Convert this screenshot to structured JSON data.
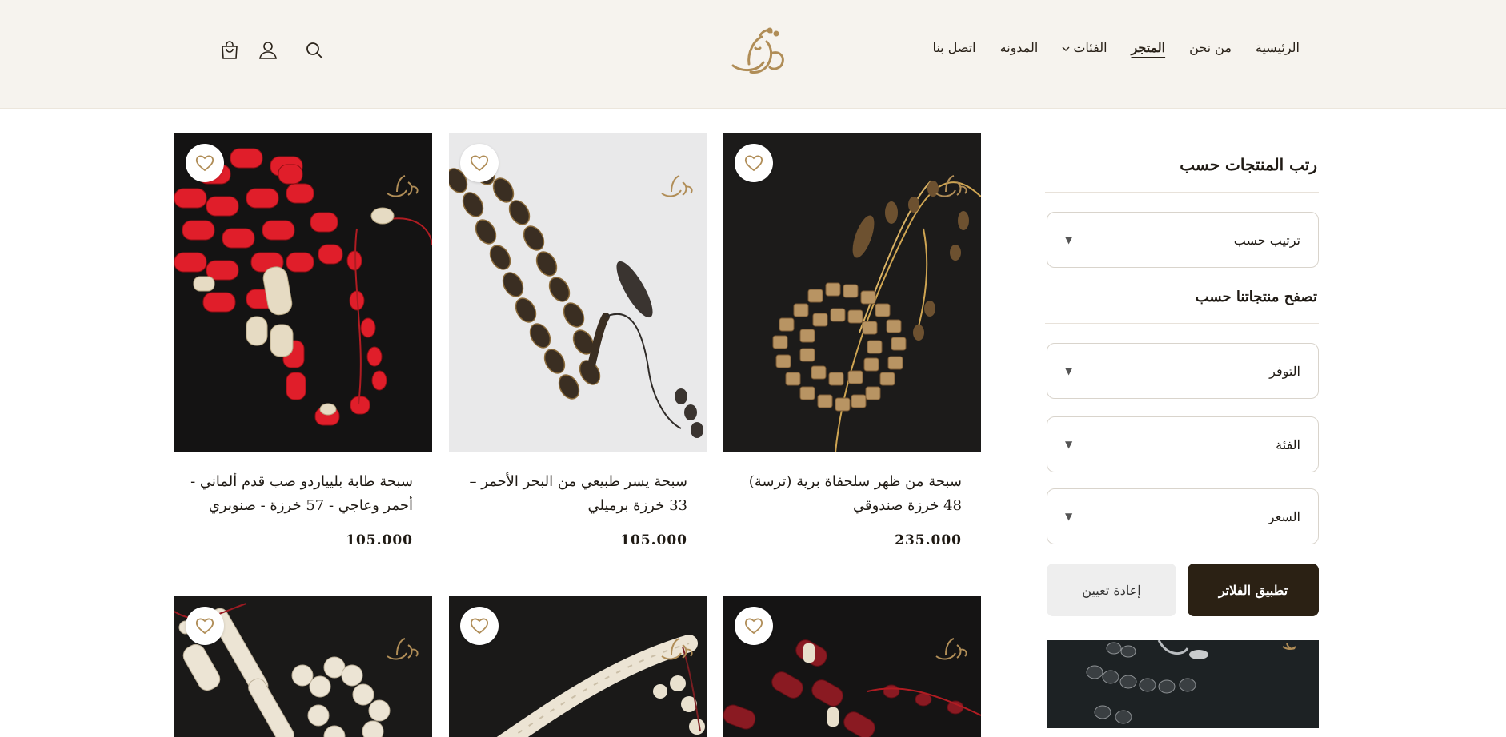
{
  "colors": {
    "header_bg": "#f6f3ee",
    "gold": "#b08d57",
    "apply_bg": "#2b2114"
  },
  "header": {
    "nav": [
      {
        "label": "الرئيسية",
        "active": false
      },
      {
        "label": "من نحن",
        "active": false
      },
      {
        "label": "المتجر",
        "active": true
      },
      {
        "label": "الفئات",
        "active": false,
        "dropdown": true
      },
      {
        "label": "المدونه",
        "active": false
      },
      {
        "label": "اتصل بنا",
        "active": false
      }
    ],
    "icons": [
      "search-icon",
      "user-icon",
      "cart-icon"
    ]
  },
  "sidebar": {
    "sort_title": "رتب المنتجات حسب",
    "sort_select": "ترتيب حسب",
    "browse_title": "تصفح منتجاتنا حسب",
    "filters": [
      "التوفر",
      "الفئة",
      "السعر"
    ],
    "apply_label": "تطبيق الفلاتر",
    "reset_label": "إعادة تعيين"
  },
  "products": [
    {
      "title": "سبحة من ظهر سلحفاة برية (ترسة) 48 خرزة صندوقي",
      "price": "235.000"
    },
    {
      "title": "سبحة يسر طبيعي من البحر الأحمر – 33 خرزة برميلي",
      "price": "105.000"
    },
    {
      "title": "سبحة طابة بليياردو صب قدم ألماني - أحمر وعاجي - 57 خرزة - صنوبري",
      "price": "105.000"
    }
  ]
}
